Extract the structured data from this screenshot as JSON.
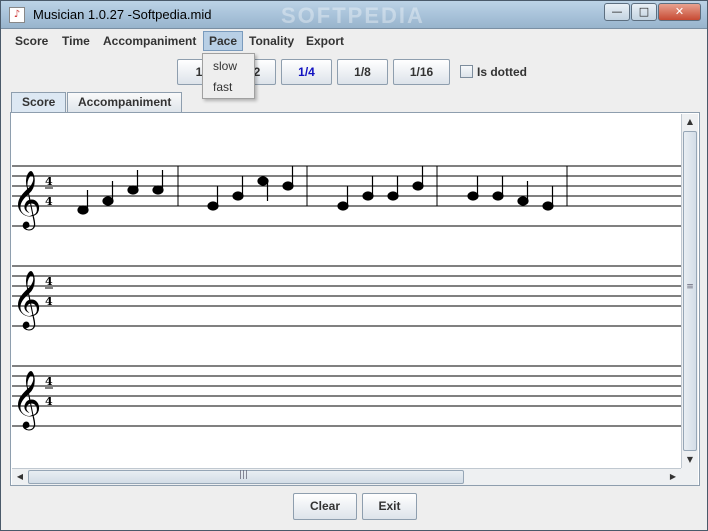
{
  "window": {
    "title": "Musician 1.0.27 -Softpedia.mid",
    "watermark": "SOFTPEDIA",
    "minimize": "—",
    "maximize": "□",
    "close": "✕"
  },
  "menubar": {
    "items": [
      {
        "label": "Score"
      },
      {
        "label": "Time"
      },
      {
        "label": "Accompaniment"
      },
      {
        "label": "Pace",
        "active": true
      },
      {
        "label": "Tonality"
      },
      {
        "label": "Export"
      }
    ]
  },
  "pace_menu": {
    "items": [
      "slow",
      "fast"
    ]
  },
  "toolbar": {
    "durations": [
      "1",
      "1/2",
      "1/4",
      "1/8",
      "1/16"
    ],
    "selected": "1/4",
    "dotted_label": "Is dotted",
    "dotted_checked": false
  },
  "tabs": {
    "items": [
      {
        "label": "Score",
        "selected": true
      },
      {
        "label": "Accompaniment",
        "selected": false
      }
    ]
  },
  "score": {
    "time_signature": {
      "top": "4",
      "bottom": "4"
    },
    "clef_glyph": "𝄞",
    "staves": [
      {
        "notes": true
      },
      {
        "notes": false
      },
      {
        "notes": false
      }
    ]
  },
  "buttons": {
    "clear": "Clear",
    "exit": "Exit"
  },
  "scrollbars": {
    "up": "▲",
    "down": "▼",
    "left": "◀",
    "right": "▶",
    "grip": "≡"
  }
}
